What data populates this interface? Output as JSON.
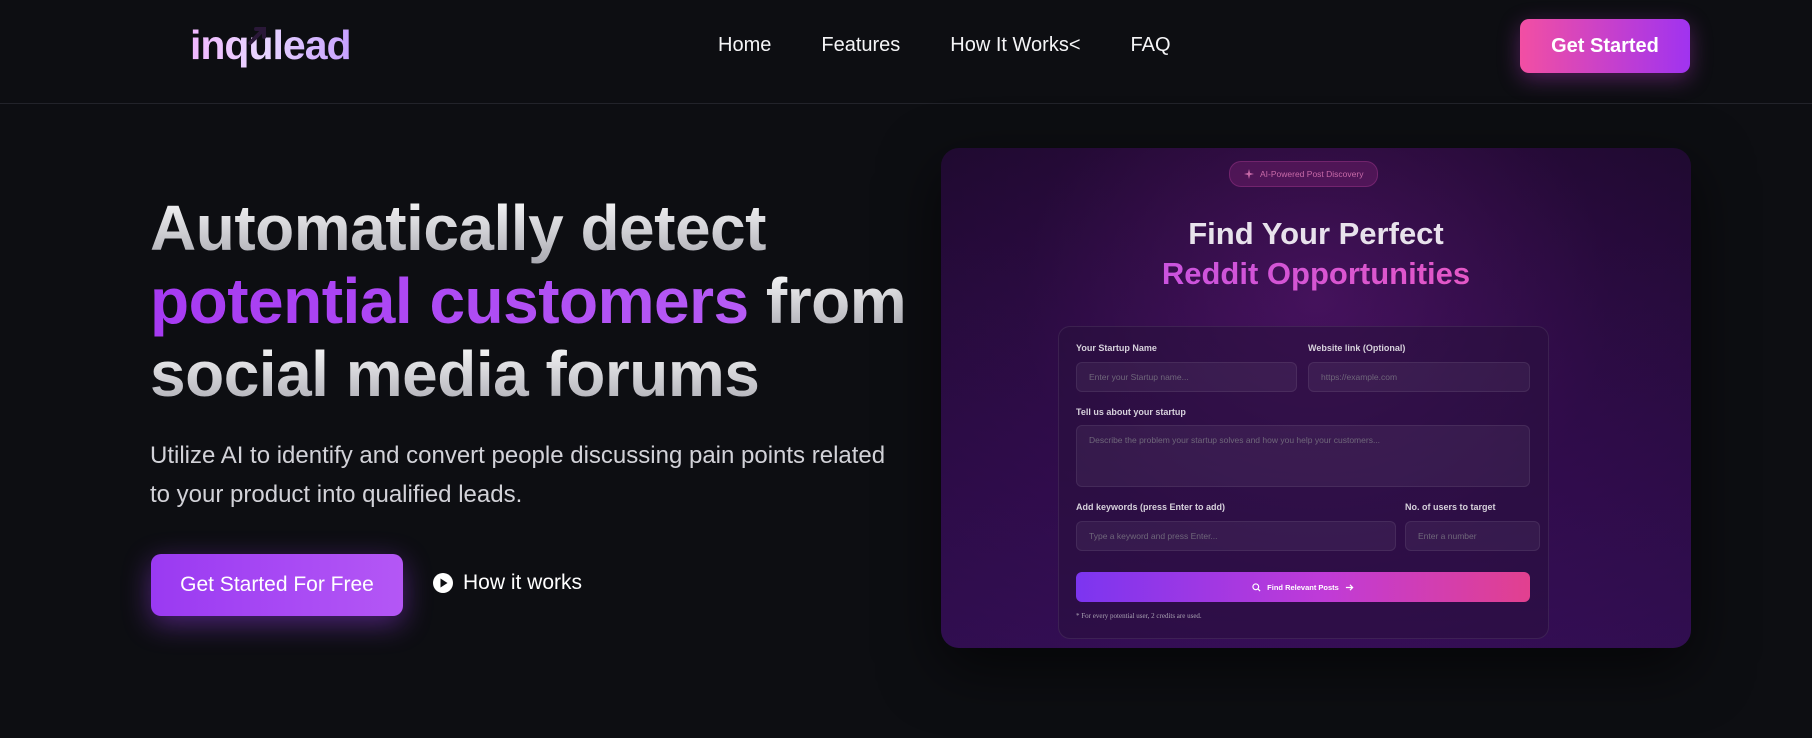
{
  "brand": {
    "logo_text": "inqulead"
  },
  "nav": {
    "links": [
      "Home",
      "Features",
      "How It Works<",
      "FAQ"
    ],
    "cta_label": "Get Started"
  },
  "hero": {
    "title_line1": "Automatically detect",
    "title_highlight": "potential customers",
    "title_after_highlight": " from",
    "title_line3": "social media forums",
    "subtitle": "Utilize AI to identify and convert people discussing pain points related to your product into qualified leads.",
    "primary_cta": "Get Started For Free",
    "secondary_cta": "How it works"
  },
  "preview": {
    "badge": "AI-Powered Post Discovery",
    "title_line1": "Find Your Perfect",
    "title_line2": "Reddit Opportunities",
    "fields": {
      "startup_name_label": "Your Startup Name",
      "startup_name_placeholder": "Enter your Startup name...",
      "website_label": "Website link (Optional)",
      "website_placeholder": "https://example.com",
      "about_label": "Tell us about your startup",
      "about_placeholder": "Describe the problem your startup solves and how you help your customers...",
      "keywords_label": "Add keywords (press Enter to add)",
      "keywords_placeholder": "Type a keyword and press Enter...",
      "users_label": "No. of users to target",
      "users_placeholder": "Enter a number"
    },
    "submit_label": "Find Relevant Posts",
    "note": "* For every potential user, 2 credits are used."
  },
  "colors": {
    "background": "#0d0e12",
    "accent_purple": "#a63af2",
    "accent_pink": "#f24fa3"
  },
  "icons": [
    "play-circle-icon",
    "sparkle-icon",
    "search-icon",
    "arrow-right-icon",
    "logo-arrow-icon"
  ]
}
